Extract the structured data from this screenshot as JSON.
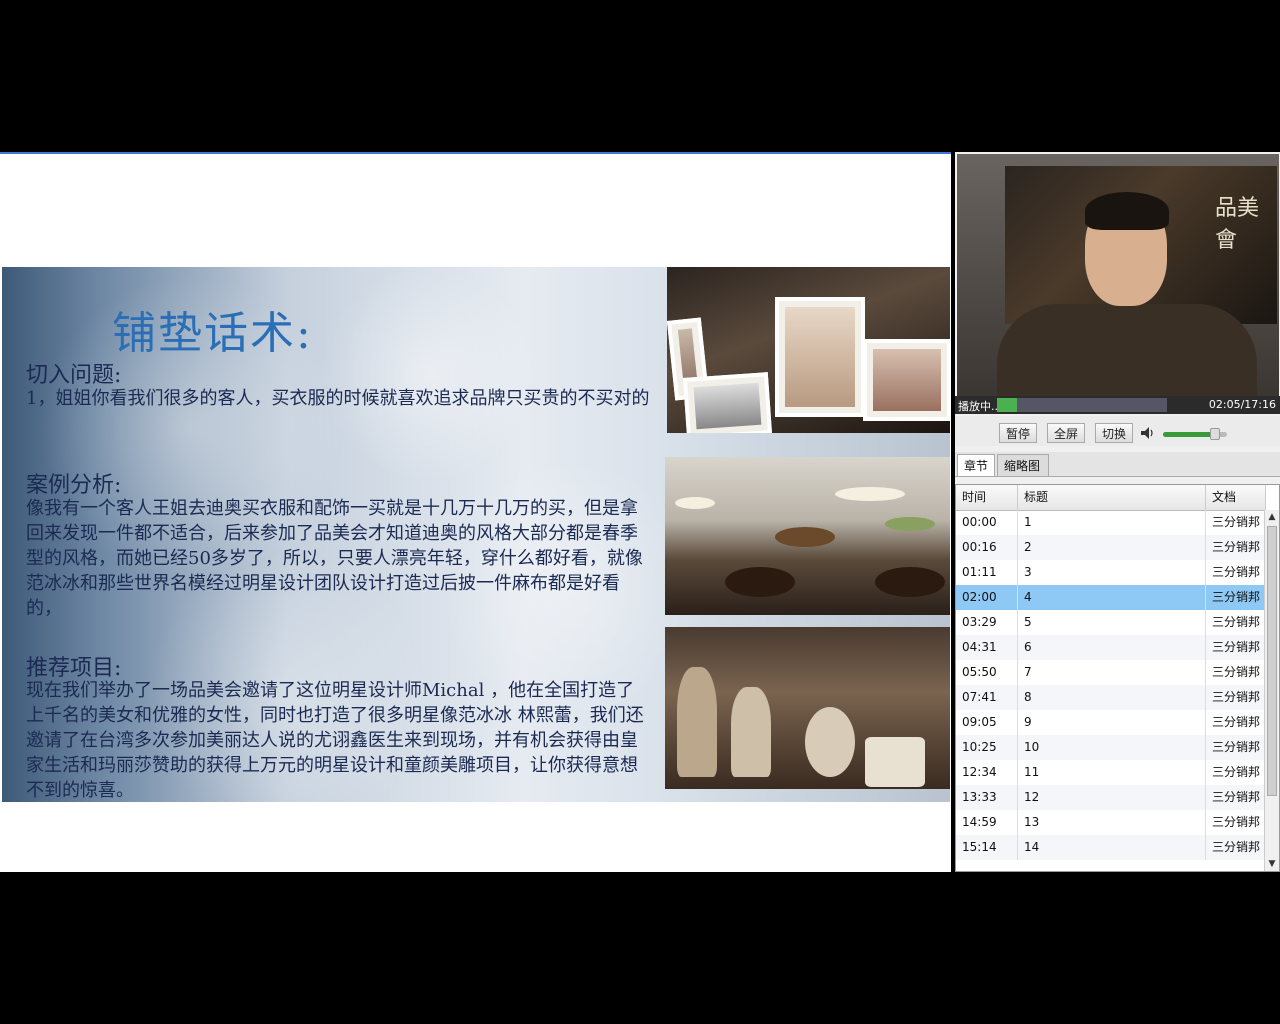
{
  "slide": {
    "title": "铺垫话术:",
    "section1": {
      "heading": "切入问题:",
      "body": "1，姐姐你看我们很多的客人，买衣服的时候就喜欢追求品牌只买贵的不买对的"
    },
    "section2": {
      "heading": "案例分析:",
      "body": "像我有一个客人王姐去迪奥买衣服和配饰一买就是十几万十几万的买，但是拿回来发现一件都不适合，后来参加了品美会才知道迪奥的风格大部分都是春季型的风格，而她已经50多岁了，所以，只要人漂亮年轻，穿什么都好看，就像范冰冰和那些世界名模经过明星设计团队设计打造过后披一件麻布都是好看的，"
    },
    "section3": {
      "heading": "推荐项目:",
      "body": "现在我们举办了一场品美会邀请了这位明星设计师Michal ，他在全国打造了上千名的美女和优雅的女性，同时也打造了很多明星像范冰冰 林熙蕾，我们还邀请了在台湾多次参加美丽达人说的尤诩鑫医生来到现场，并有机会获得由皇家生活和玛丽莎赞助的获得上万元的明星设计和童颜美雕项目，让你获得意想不到的惊喜。"
    }
  },
  "video": {
    "projector_text": "品美會",
    "status": "播放中...",
    "progress_fraction": 0.12,
    "time": "02:05/17:16"
  },
  "controls": {
    "pause": "暂停",
    "fullscreen": "全屏",
    "switch": "切换",
    "volume_fraction": 0.82
  },
  "tabs": {
    "chapters": "章节",
    "thumbnails": "缩略图"
  },
  "table": {
    "headers": {
      "time": "时间",
      "title": "标题",
      "doc": "文档"
    },
    "selected_index": 3,
    "rows": [
      {
        "time": "00:00",
        "title": "1",
        "doc": "三分销邦"
      },
      {
        "time": "00:16",
        "title": "2",
        "doc": "三分销邦"
      },
      {
        "time": "01:11",
        "title": "3",
        "doc": "三分销邦"
      },
      {
        "time": "02:00",
        "title": "4",
        "doc": "三分销邦"
      },
      {
        "time": "03:29",
        "title": "5",
        "doc": "三分销邦"
      },
      {
        "time": "04:31",
        "title": "6",
        "doc": "三分销邦"
      },
      {
        "time": "05:50",
        "title": "7",
        "doc": "三分销邦"
      },
      {
        "time": "07:41",
        "title": "8",
        "doc": "三分销邦"
      },
      {
        "time": "09:05",
        "title": "9",
        "doc": "三分销邦"
      },
      {
        "time": "10:25",
        "title": "10",
        "doc": "三分销邦"
      },
      {
        "time": "12:34",
        "title": "11",
        "doc": "三分销邦"
      },
      {
        "time": "13:33",
        "title": "12",
        "doc": "三分销邦"
      },
      {
        "time": "14:59",
        "title": "13",
        "doc": "三分销邦"
      },
      {
        "time": "15:14",
        "title": "14",
        "doc": "三分销邦"
      }
    ]
  },
  "colors": {
    "title_blue": "#2a6fb5",
    "text_navy": "#1b2a52",
    "progress_green": "#4caf50",
    "selected_row": "#8ec8f5"
  }
}
